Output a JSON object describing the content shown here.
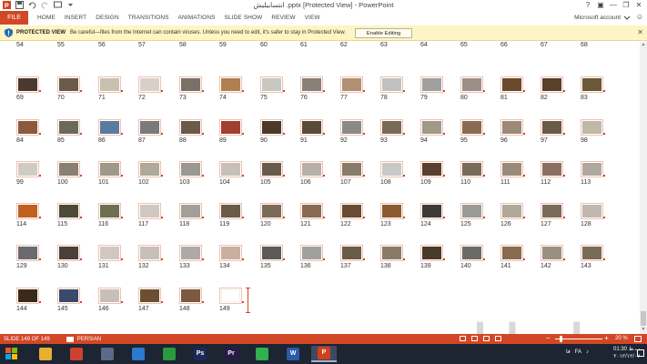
{
  "window": {
    "title": "انتسابیلیش .pptx [Protected View] - PowerPoint",
    "help_label": "?",
    "account_label": "Microsoft account",
    "minimize_label": "—",
    "restore_label": "❐",
    "close_label": "✕"
  },
  "ribbon": {
    "file_label": "FILE",
    "tabs": [
      "HOME",
      "INSERT",
      "DESIGN",
      "TRANSITIONS",
      "ANIMATIONS",
      "SLIDE SHOW",
      "REVIEW",
      "VIEW"
    ]
  },
  "protected_view": {
    "label": "PROTECTED VIEW",
    "message": "Be careful—files from the Internet can contain viruses. Unless you need to edit, it's safer to stay in Protected View.",
    "button_label": "Enable Editing",
    "close_label": "✕"
  },
  "slides": [
    {
      "n": "54",
      "c": "#6a5e4e"
    },
    {
      "n": "55",
      "c": "#5a4a3e"
    },
    {
      "n": "56",
      "c": "#c0b8a8"
    },
    {
      "n": "57",
      "c": "#7a6e62"
    },
    {
      "n": "58",
      "c": "#a08060"
    },
    {
      "n": "59",
      "c": "#6a503a"
    },
    {
      "n": "60",
      "c": "#d0c8c0"
    },
    {
      "n": "61",
      "c": "#8a8070"
    },
    {
      "n": "62",
      "c": "#b0a898"
    },
    {
      "n": "63",
      "c": "#7a6a5a"
    },
    {
      "n": "64",
      "c": "#5a4a3a"
    },
    {
      "n": "65",
      "c": "#8a7a6a"
    },
    {
      "n": "66",
      "c": "#a09080"
    },
    {
      "n": "67",
      "c": "#6a5040"
    },
    {
      "n": "68",
      "c": "#7a6048"
    },
    {
      "n": "69",
      "c": "#4a3a2e"
    },
    {
      "n": "70",
      "c": "#6a5a4a"
    },
    {
      "n": "71",
      "c": "#c8c0b0"
    },
    {
      "n": "72",
      "c": "#d8d0c8"
    },
    {
      "n": "73",
      "c": "#7a7068"
    },
    {
      "n": "74",
      "c": "#b08050"
    },
    {
      "n": "75",
      "c": "#c8c8c0"
    },
    {
      "n": "76",
      "c": "#8a8078"
    },
    {
      "n": "77",
      "c": "#b09070"
    },
    {
      "n": "78",
      "c": "#c0c0c0"
    },
    {
      "n": "79",
      "c": "#a0a0a0"
    },
    {
      "n": "80",
      "c": "#9a9088"
    },
    {
      "n": "81",
      "c": "#6a4a2a"
    },
    {
      "n": "82",
      "c": "#5a4028"
    },
    {
      "n": "83",
      "c": "#6a5838"
    },
    {
      "n": "84",
      "c": "#8a5a3a"
    },
    {
      "n": "85",
      "c": "#6a6a5a"
    },
    {
      "n": "86",
      "c": "#5a7aa0"
    },
    {
      "n": "87",
      "c": "#7a7a7a"
    },
    {
      "n": "88",
      "c": "#6a5a4a"
    },
    {
      "n": "89",
      "c": "#a04030"
    },
    {
      "n": "90",
      "c": "#4a3a2a"
    },
    {
      "n": "91",
      "c": "#5a4a3a"
    },
    {
      "n": "92",
      "c": "#8a8a88"
    },
    {
      "n": "93",
      "c": "#7a6a58"
    },
    {
      "n": "94",
      "c": "#a09888"
    },
    {
      "n": "95",
      "c": "#8a6a50"
    },
    {
      "n": "96",
      "c": "#9a8a78"
    },
    {
      "n": "97",
      "c": "#6a5a48"
    },
    {
      "n": "98",
      "c": "#c0b8a8"
    },
    {
      "n": "99",
      "c": "#d0ccc4"
    },
    {
      "n": "100",
      "c": "#8a8070"
    },
    {
      "n": "101",
      "c": "#a09888"
    },
    {
      "n": "102",
      "c": "#b0a898"
    },
    {
      "n": "103",
      "c": "#9a9890"
    },
    {
      "n": "104",
      "c": "#c8c0b8"
    },
    {
      "n": "105",
      "c": "#6a5a4a"
    },
    {
      "n": "106",
      "c": "#b8b0a8"
    },
    {
      "n": "107",
      "c": "#8a7a68"
    },
    {
      "n": "108",
      "c": "#c8c8c8"
    },
    {
      "n": "109",
      "c": "#5a4030"
    },
    {
      "n": "110",
      "c": "#7a6a58"
    },
    {
      "n": "111",
      "c": "#9a8a78"
    },
    {
      "n": "112",
      "c": "#8a7060"
    },
    {
      "n": "113",
      "c": "#b0a8a0"
    },
    {
      "n": "114",
      "c": "#c06020"
    },
    {
      "n": "115",
      "c": "#4a4a3a"
    },
    {
      "n": "116",
      "c": "#6a7050"
    },
    {
      "n": "117",
      "c": "#d0c8c0"
    },
    {
      "n": "118",
      "c": "#a0a098"
    },
    {
      "n": "119",
      "c": "#6a5a48"
    },
    {
      "n": "120",
      "c": "#7a6a58"
    },
    {
      "n": "121",
      "c": "#8a6a50"
    },
    {
      "n": "122",
      "c": "#6a4a30"
    },
    {
      "n": "123",
      "c": "#8a5a30"
    },
    {
      "n": "124",
      "c": "#3a3a3a"
    },
    {
      "n": "125",
      "c": "#9a9a98"
    },
    {
      "n": "126",
      "c": "#b0a898"
    },
    {
      "n": "127",
      "c": "#7a6a5a"
    },
    {
      "n": "128",
      "c": "#c0b8b0"
    },
    {
      "n": "129",
      "c": "#6a6a70"
    },
    {
      "n": "130",
      "c": "#4a4038"
    },
    {
      "n": "131",
      "c": "#d0c8c0"
    },
    {
      "n": "132",
      "c": "#c8c0b8"
    },
    {
      "n": "133",
      "c": "#b0a8a8"
    },
    {
      "n": "134",
      "c": "#c8b0a0"
    },
    {
      "n": "135",
      "c": "#5a5a5a"
    },
    {
      "n": "136",
      "c": "#a0a0a0"
    },
    {
      "n": "137",
      "c": "#6a5a48"
    },
    {
      "n": "138",
      "c": "#8a7a68"
    },
    {
      "n": "139",
      "c": "#4a3a2a"
    },
    {
      "n": "140",
      "c": "#6a6a68"
    },
    {
      "n": "141",
      "c": "#8a6a50"
    },
    {
      "n": "142",
      "c": "#9a9080"
    },
    {
      "n": "143",
      "c": "#7a6a58"
    },
    {
      "n": "144",
      "c": "#3a2a1a"
    },
    {
      "n": "145",
      "c": "#3a4a6a"
    },
    {
      "n": "146",
      "c": "#c8c0b8"
    },
    {
      "n": "147",
      "c": "#6a5030"
    },
    {
      "n": "148",
      "c": "#7a5a40"
    },
    {
      "n": "149",
      "c": "#ffffff"
    }
  ],
  "watermark": "بابساطی",
  "statusbar": {
    "slide_count": "SLIDE 149 OF 149",
    "language": "PERSIAN",
    "zoom_minus": "−",
    "zoom_plus": "+",
    "zoom": "20 %",
    "zoom_percent": 20
  },
  "taskbar": {
    "apps": [
      {
        "name": "file-explorer-icon",
        "label": "",
        "color": "#e8b030"
      },
      {
        "name": "chrome-icon",
        "label": "",
        "color": "#d04030"
      },
      {
        "name": "disk-icon",
        "label": "",
        "color": "#5a6a8a"
      },
      {
        "name": "refresh-icon",
        "label": "",
        "color": "#2a7ad0"
      },
      {
        "name": "calculator-icon",
        "label": "",
        "color": "#2a9a40"
      },
      {
        "name": "photoshop-icon",
        "label": "Ps",
        "color": "#1a2a5a"
      },
      {
        "name": "premiere-icon",
        "label": "Pr",
        "color": "#2a1a4a"
      },
      {
        "name": "whatsapp-icon",
        "label": "",
        "color": "#30b050"
      },
      {
        "name": "word-icon",
        "label": "W",
        "color": "#2a5aa8"
      },
      {
        "name": "powerpoint-icon",
        "label": "P",
        "color": "#d04020"
      }
    ],
    "tray_lang": "FA",
    "tray_lang2": "فا",
    "time": "01:30 ب.ظ",
    "date": "۲۰۱۲/۱۲/۰۷"
  }
}
